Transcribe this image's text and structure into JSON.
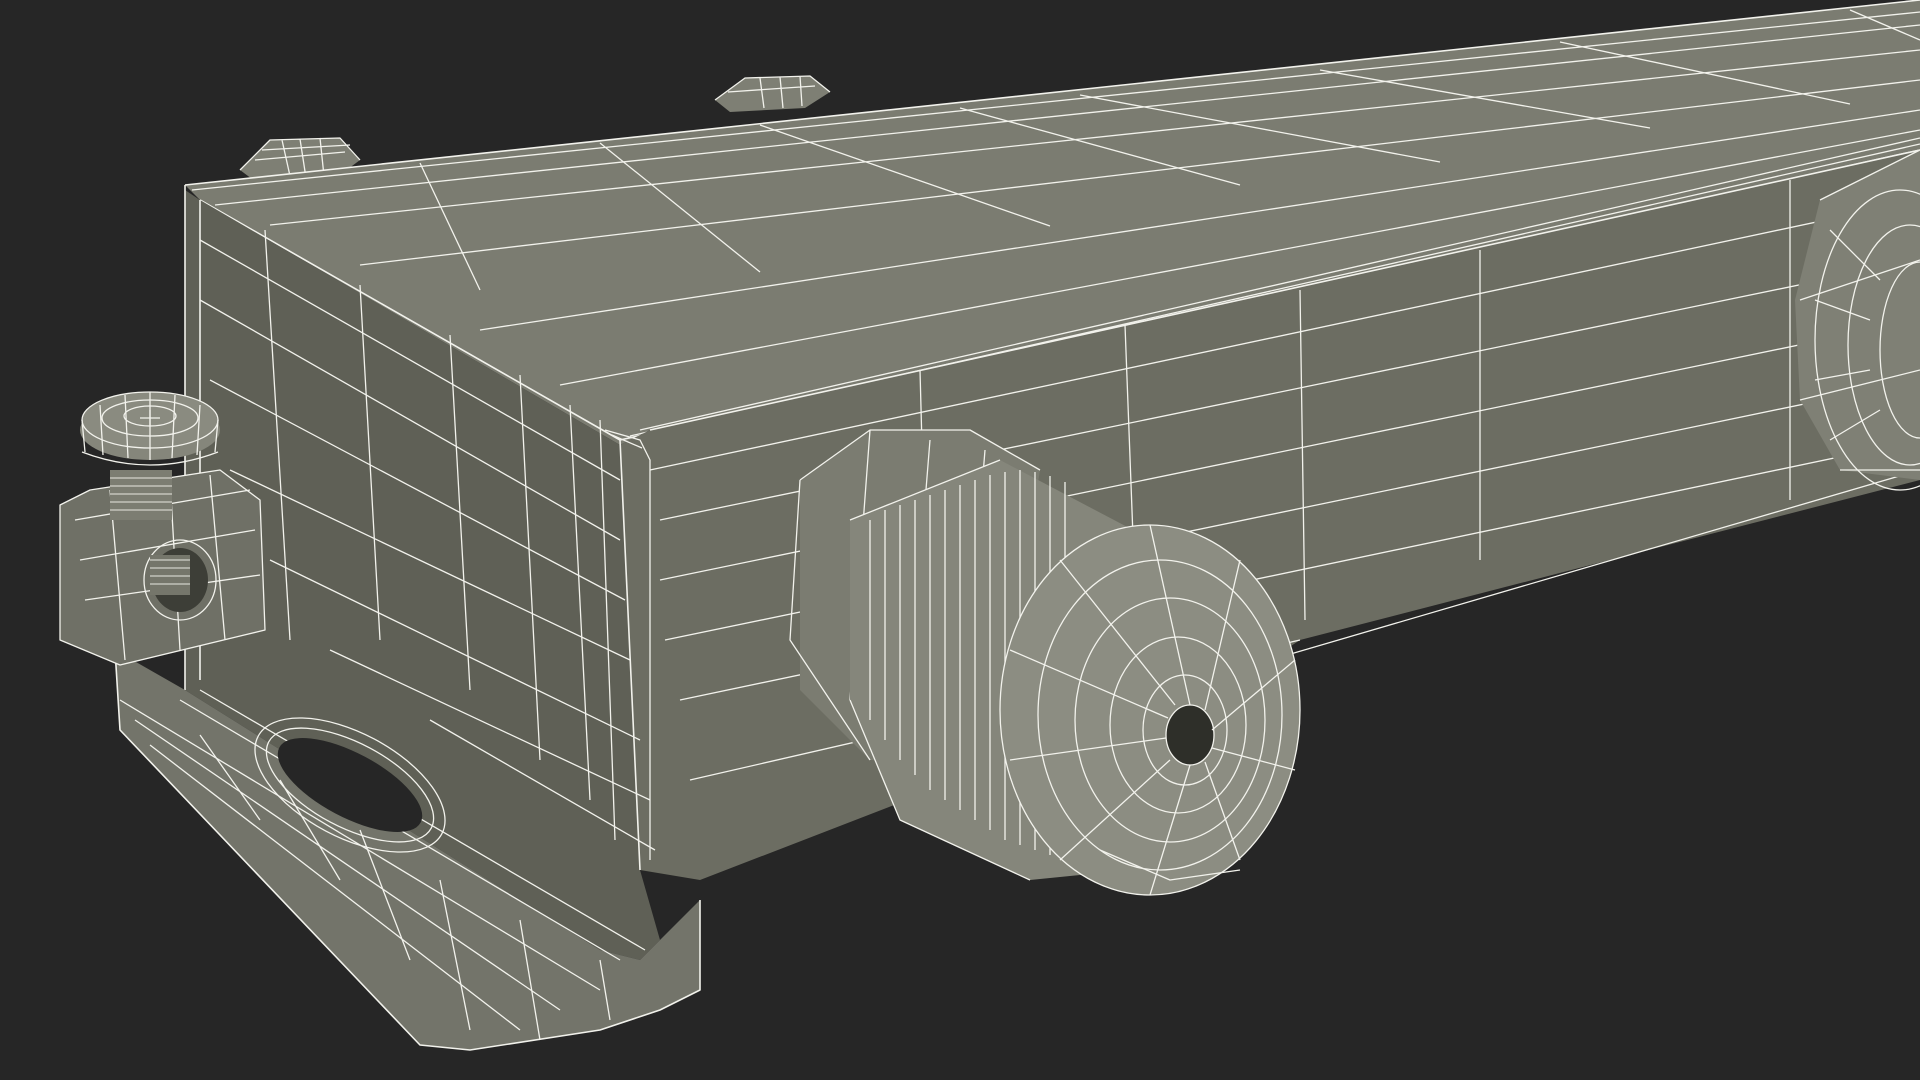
{
  "scene": {
    "background_color": "#262626",
    "wire_color": "#f2f2ec",
    "surface_colors": {
      "top": "#7b7c71",
      "front": "#6c6d62",
      "side": "#5f6056",
      "flange": "#73746a",
      "gland": "#85867b",
      "shadow": "#52534a"
    }
  }
}
